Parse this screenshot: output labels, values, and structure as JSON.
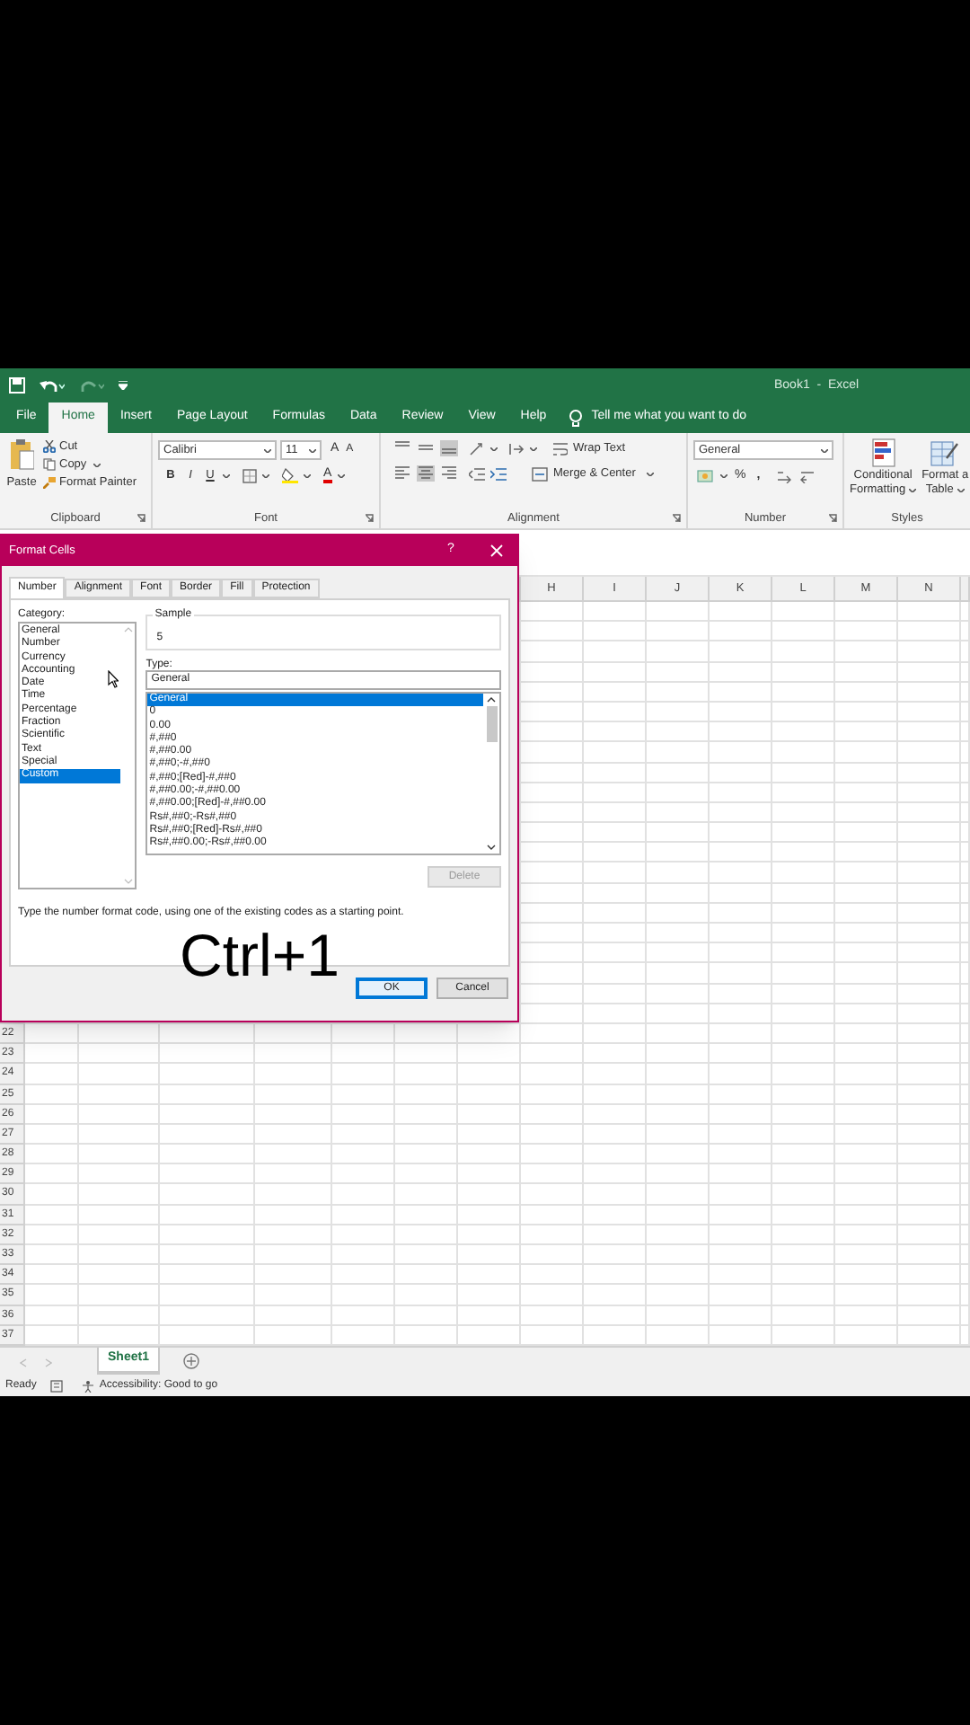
{
  "window": {
    "title": "Book1  -  Excel"
  },
  "ribbon_tabs": [
    {
      "label": "File",
      "selected": false
    },
    {
      "label": "Home",
      "selected": true
    },
    {
      "label": "Insert",
      "selected": false
    },
    {
      "label": "Page Layout",
      "selected": false
    },
    {
      "label": "Formulas",
      "selected": false
    },
    {
      "label": "Data",
      "selected": false
    },
    {
      "label": "Review",
      "selected": false
    },
    {
      "label": "View",
      "selected": false
    },
    {
      "label": "Help",
      "selected": false
    }
  ],
  "tell_me": "Tell me what you want to do",
  "ribbon": {
    "clipboard": {
      "paste": "Paste",
      "cut": "Cut",
      "copy": "Copy",
      "format_painter": "Format Painter",
      "label": "Clipboard"
    },
    "font": {
      "font_name": "Calibri",
      "font_size": "11",
      "grow": "A",
      "shrink": "A",
      "bold": "B",
      "italic": "I",
      "underline": "U",
      "font_color": "A",
      "label": "Font"
    },
    "alignment": {
      "wrap_text": "Wrap Text",
      "merge": "Merge & Center",
      "label": "Alignment"
    },
    "number": {
      "format": "General",
      "percent": "%",
      "comma": ",",
      "label": "Number"
    },
    "styles": {
      "conditional_formatting": [
        "Conditional",
        "Formatting"
      ],
      "format_as_table": [
        "Format a",
        "Table"
      ],
      "label": "Styles"
    }
  },
  "dialog": {
    "title": "Format Cells",
    "help": "?",
    "tabs": [
      {
        "label": "Number",
        "selected": true
      },
      {
        "label": "Alignment",
        "selected": false
      },
      {
        "label": "Font",
        "selected": false
      },
      {
        "label": "Border",
        "selected": false
      },
      {
        "label": "Fill",
        "selected": false
      },
      {
        "label": "Protection",
        "selected": false
      }
    ],
    "category_label": "Category:",
    "categories": [
      {
        "label": "General",
        "selected": false
      },
      {
        "label": "Number",
        "selected": false
      },
      {
        "label": "Currency",
        "selected": false
      },
      {
        "label": "Accounting",
        "selected": false
      },
      {
        "label": "Date",
        "selected": false
      },
      {
        "label": "Time",
        "selected": false
      },
      {
        "label": "Percentage",
        "selected": false
      },
      {
        "label": "Fraction",
        "selected": false
      },
      {
        "label": "Scientific",
        "selected": false
      },
      {
        "label": "Text",
        "selected": false
      },
      {
        "label": "Special",
        "selected": false
      },
      {
        "label": "Custom",
        "selected": true
      }
    ],
    "sample_label": "Sample",
    "sample_value": "5",
    "type_label": "Type:",
    "type_value": "General",
    "type_list": [
      {
        "label": "General",
        "selected": true
      },
      {
        "label": "0",
        "selected": false
      },
      {
        "label": "0.00",
        "selected": false
      },
      {
        "label": "#,##0",
        "selected": false
      },
      {
        "label": "#,##0.00",
        "selected": false
      },
      {
        "label": "#,##0;-#,##0",
        "selected": false
      },
      {
        "label": "#,##0;[Red]-#,##0",
        "selected": false
      },
      {
        "label": "#,##0.00;-#,##0.00",
        "selected": false
      },
      {
        "label": "#,##0.00;[Red]-#,##0.00",
        "selected": false
      },
      {
        "label": "Rs#,##0;-Rs#,##0",
        "selected": false
      },
      {
        "label": "Rs#,##0;[Red]-Rs#,##0",
        "selected": false
      },
      {
        "label": "Rs#,##0.00;-Rs#,##0.00",
        "selected": false
      }
    ],
    "delete_button": {
      "label": "Delete",
      "disabled": true
    },
    "hint": "Type the number format code, using one of the existing codes as a starting point.",
    "caption": "Ctrl+1",
    "buttons": [
      {
        "label": "OK",
        "kind": "default"
      },
      {
        "label": "Cancel",
        "kind": "normal"
      }
    ]
  },
  "sheet": {
    "column_headers": [
      "H",
      "I",
      "J",
      "K",
      "L",
      "M",
      "N"
    ],
    "row_headers": [
      "22",
      "23",
      "24",
      "25",
      "26",
      "27",
      "28",
      "29",
      "30",
      "31",
      "32",
      "33",
      "34",
      "35",
      "36",
      "37"
    ]
  },
  "sheet_tabs": [
    {
      "label": "Sheet1",
      "selected": true
    }
  ],
  "status_bar": {
    "mode": "Ready",
    "accessibility": "Accessibility: Good to go"
  }
}
